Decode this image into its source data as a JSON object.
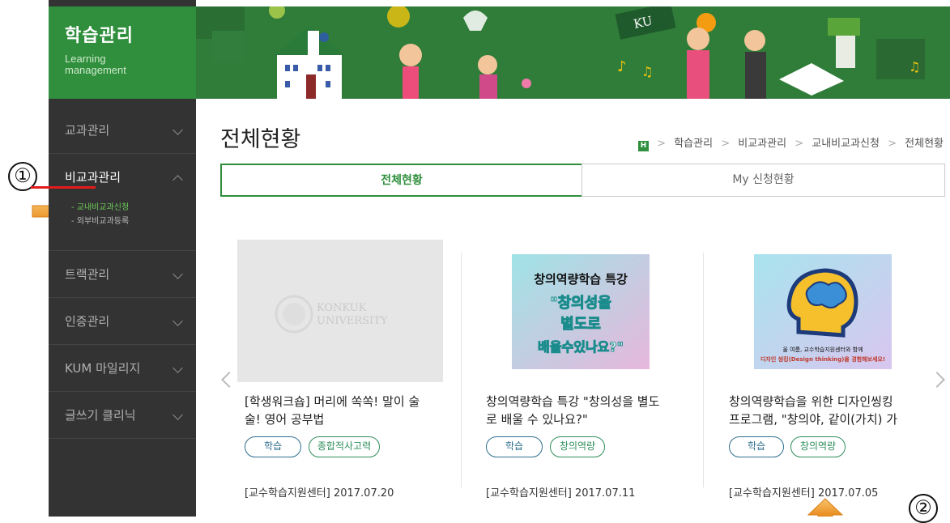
{
  "annotations": {
    "marker_1": "①",
    "marker_2": "②"
  },
  "sidebar": {
    "title": "학습관리",
    "subtitle_line1": "Learning",
    "subtitle_line2": "management",
    "items": [
      {
        "label": "교과관리"
      },
      {
        "label": "비교과관리"
      },
      {
        "label": "트랙관리"
      },
      {
        "label": "인증관리"
      },
      {
        "label": "KUM 마일리지"
      },
      {
        "label": "글쓰기 클리닉"
      }
    ],
    "submenu": [
      {
        "label": "- 교내비교과신청"
      },
      {
        "label": "- 외부비교과등록"
      }
    ]
  },
  "banner": {
    "badge_text": "KU"
  },
  "page": {
    "title": "전체현황"
  },
  "breadcrumb": {
    "home": "H",
    "sep": ">",
    "items": [
      "학습관리",
      "비교과관리",
      "교내비교과신청",
      "전체현황"
    ]
  },
  "tabs": [
    {
      "label": "전체현황"
    },
    {
      "label": "My 신청현황"
    }
  ],
  "cards": [
    {
      "image_text_1": "KONKUK",
      "image_text_2": "UNIVERSITY",
      "title_line1": "[학생워크숍] 머리에 쏙쏙! 말이 술",
      "title_line2": "술! 영어 공부법",
      "tags": [
        "학습",
        "종합적사고력"
      ],
      "meta": "[교수학습지원센터] 2017.07.20"
    },
    {
      "image_text_1": "창의역량학습 특강",
      "image_text_2": "\"창의성을",
      "image_text_3": "별도로",
      "image_text_4": "배울수있나요?\"",
      "title_line1": "창의역량학습 특강 \"창의성을 별도",
      "title_line2": "로 배울 수 있나요?\"",
      "tags": [
        "학습",
        "창의역량"
      ],
      "meta": "[교수학습지원센터] 2017.07.11"
    },
    {
      "image_text_1": "올 여름, 교수학습지원센터와 함께",
      "image_text_2": "디자인 씽킹(Design thinking)을 경험해보세요!",
      "title_line1": "창의역량학습을 위한 디자인씽킹",
      "title_line2": "프로그램, \"창의야, 같이(가치) 가",
      "tags": [
        "학습",
        "창의역량"
      ],
      "meta": "[교수학습지원센터] 2017.07.05"
    }
  ],
  "colors": {
    "green": "#2f8f3c",
    "sidebar": "#333333",
    "accent_red": "#e31b1b",
    "orange": "#f3a53a"
  }
}
